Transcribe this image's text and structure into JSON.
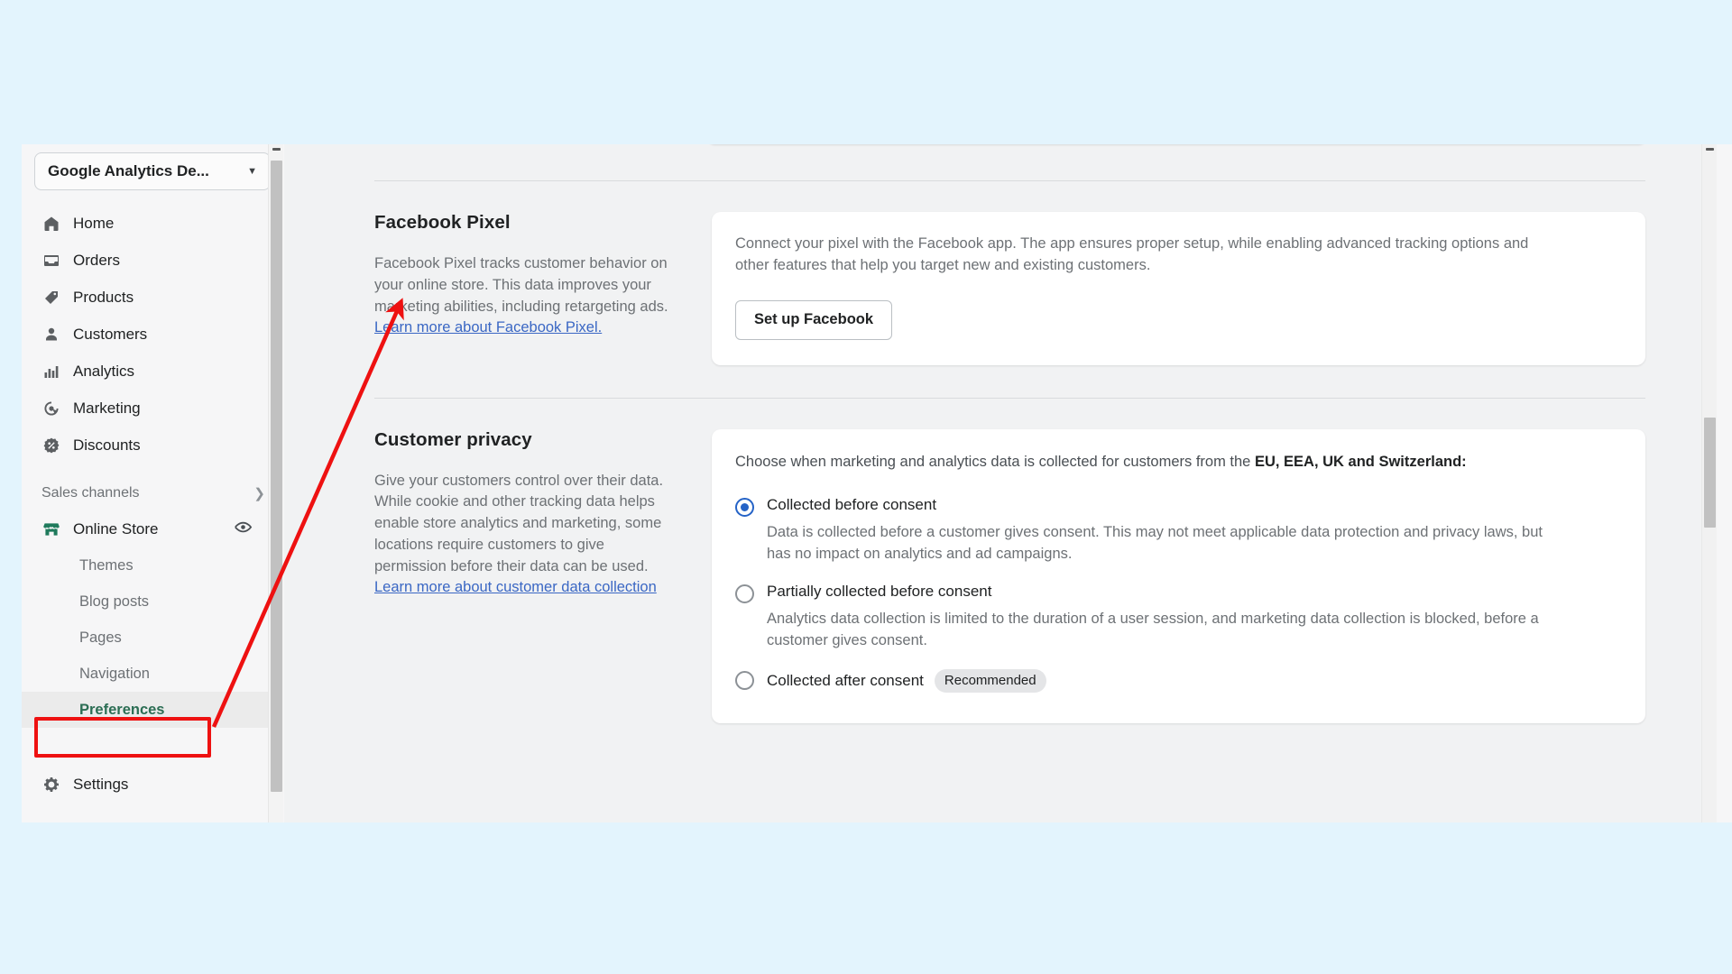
{
  "colors": {
    "page_background": "#e3f4fd",
    "app_background": "#f6f6f7",
    "main_background": "#f1f2f3",
    "link": "#3a67c4",
    "selected_nav_text": "#2c6e54",
    "radio_selected": "#2563c7",
    "annotation": "#ee1111",
    "store_icon": "#1f7a5c"
  },
  "sidebar": {
    "store_switcher": {
      "label": "Google Analytics De...",
      "caret_icon": "chevron-down-icon"
    },
    "items": [
      {
        "label": "Home",
        "icon": "home-icon"
      },
      {
        "label": "Orders",
        "icon": "orders-inbox-icon"
      },
      {
        "label": "Products",
        "icon": "product-tag-icon"
      },
      {
        "label": "Customers",
        "icon": "customer-person-icon"
      },
      {
        "label": "Analytics",
        "icon": "analytics-bars-icon"
      },
      {
        "label": "Marketing",
        "icon": "marketing-target-icon"
      },
      {
        "label": "Discounts",
        "icon": "discount-percent-icon"
      }
    ],
    "sales_channels": {
      "label": "Sales channels",
      "chevron_icon": "chevron-right-icon"
    },
    "online_store": {
      "label": "Online Store",
      "icon": "storefront-icon",
      "preview_icon": "eye-icon"
    },
    "sub_items": [
      {
        "label": "Themes",
        "selected": false
      },
      {
        "label": "Blog posts",
        "selected": false
      },
      {
        "label": "Pages",
        "selected": false
      },
      {
        "label": "Navigation",
        "selected": false
      },
      {
        "label": "Preferences",
        "selected": true
      }
    ],
    "settings": {
      "label": "Settings",
      "icon": "gear-icon"
    }
  },
  "facebook_pixel": {
    "title": "Facebook Pixel",
    "description": "Facebook Pixel tracks customer behavior on your online store. This data improves your marketing abilities, including retargeting ads.",
    "learn_more": "Learn more about Facebook Pixel.",
    "card_text": "Connect your pixel with the Facebook app. The app ensures proper setup, while enabling advanced tracking options and other features that help you target new and existing customers.",
    "button_label": "Set up Facebook"
  },
  "customer_privacy": {
    "title": "Customer privacy",
    "description": "Give your customers control over their data. While cookie and other tracking data helps enable store analytics and marketing, some locations require customers to give permission before their data can be used.",
    "learn_more": "Learn more about customer data collection",
    "choose_prefix": "Choose when marketing and analytics data is collected for customers from the ",
    "choose_bold": "EU, EEA, UK and Switzerland:",
    "options": [
      {
        "label": "Collected before consent",
        "selected": true,
        "badge": "",
        "help": "Data is collected before a customer gives consent. This may not meet applicable data protection and privacy laws, but has no impact on analytics and ad campaigns."
      },
      {
        "label": "Partially collected before consent",
        "selected": false,
        "badge": "",
        "help": "Analytics data collection is limited to the duration of a user session, and marketing data collection is blocked, before a customer gives consent."
      },
      {
        "label": "Collected after consent",
        "selected": false,
        "badge": "Recommended",
        "help": ""
      }
    ]
  },
  "scrollbars": {
    "sidebar_scrollbar": "vertical-scrollbar",
    "main_scrollbar": "vertical-scrollbar"
  },
  "annotation": {
    "highlight_target": "Preferences",
    "arrow_target": "Facebook Pixel"
  }
}
